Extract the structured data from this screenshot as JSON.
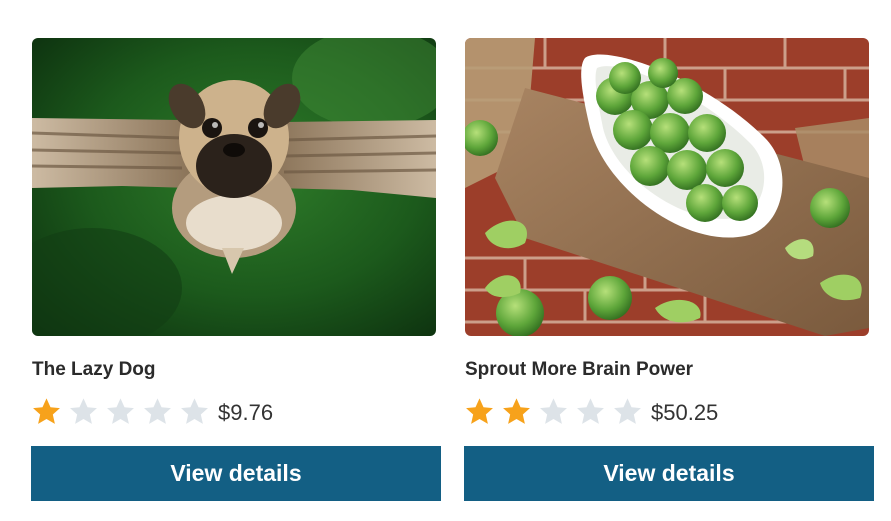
{
  "products": [
    {
      "image_alt": "pug with wings",
      "name": "The Lazy Dog",
      "rating": 1,
      "max_rating": 5,
      "price": "$9.76",
      "button_label": "View details"
    },
    {
      "image_alt": "brussels sprouts in a bowl",
      "name": "Sprout More Brain Power",
      "rating": 2,
      "max_rating": 5,
      "price": "$50.25",
      "button_label": "View details"
    }
  ],
  "colors": {
    "button_bg": "#135f84",
    "star_filled": "#f7a21b",
    "star_empty": "#dde3e8"
  },
  "icons": {
    "star": "star-icon"
  }
}
